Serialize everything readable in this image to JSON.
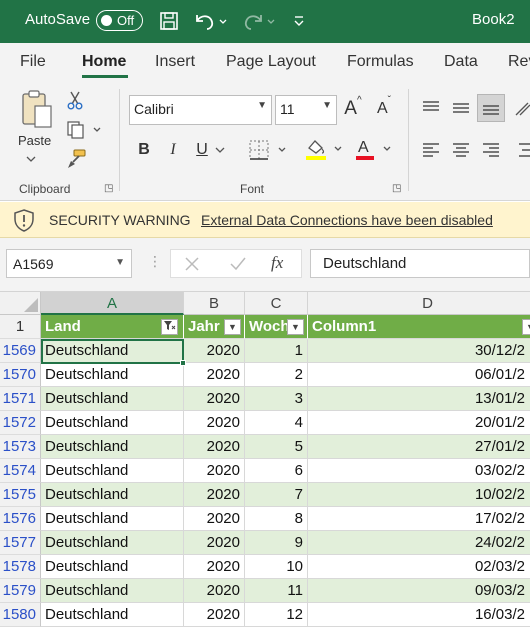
{
  "titlebar": {
    "autosave_label": "AutoSave",
    "autosave_state": "Off",
    "title": "Book2"
  },
  "menu": {
    "tabs": [
      "File",
      "Home",
      "Insert",
      "Page Layout",
      "Formulas",
      "Data",
      "Rev"
    ],
    "active": "Home"
  },
  "ribbon": {
    "paste_label": "Paste",
    "clipboard_label": "Clipboard",
    "font_label": "Font",
    "font_name": "Calibri",
    "font_size": "11",
    "bold": "B",
    "italic": "I",
    "underline": "U",
    "grow_font": "A",
    "shrink_font": "A",
    "font_color_letter": "A",
    "font_color": "#e81123",
    "highlight_color": "#ffff00"
  },
  "security": {
    "title": "SECURITY WARNING",
    "message": "External Data Connections have been disabled"
  },
  "formula_bar": {
    "name_box": "A1569",
    "fx": "fx",
    "value": "Deutschland"
  },
  "grid": {
    "columns": [
      "A",
      "B",
      "C",
      "D"
    ],
    "header_row_number": "1",
    "headers": [
      "Land",
      "Jahr",
      "Woch",
      "Column1"
    ],
    "rows": [
      {
        "num": "1569",
        "land": "Deutschland",
        "jahr": "2020",
        "woche": "1",
        "col1": "30/12/2"
      },
      {
        "num": "1570",
        "land": "Deutschland",
        "jahr": "2020",
        "woche": "2",
        "col1": "06/01/2"
      },
      {
        "num": "1571",
        "land": "Deutschland",
        "jahr": "2020",
        "woche": "3",
        "col1": "13/01/2"
      },
      {
        "num": "1572",
        "land": "Deutschland",
        "jahr": "2020",
        "woche": "4",
        "col1": "20/01/2"
      },
      {
        "num": "1573",
        "land": "Deutschland",
        "jahr": "2020",
        "woche": "5",
        "col1": "27/01/2"
      },
      {
        "num": "1574",
        "land": "Deutschland",
        "jahr": "2020",
        "woche": "6",
        "col1": "03/02/2"
      },
      {
        "num": "1575",
        "land": "Deutschland",
        "jahr": "2020",
        "woche": "7",
        "col1": "10/02/2"
      },
      {
        "num": "1576",
        "land": "Deutschland",
        "jahr": "2020",
        "woche": "8",
        "col1": "17/02/2"
      },
      {
        "num": "1577",
        "land": "Deutschland",
        "jahr": "2020",
        "woche": "9",
        "col1": "24/02/2"
      },
      {
        "num": "1578",
        "land": "Deutschland",
        "jahr": "2020",
        "woche": "10",
        "col1": "02/03/2"
      },
      {
        "num": "1579",
        "land": "Deutschland",
        "jahr": "2020",
        "woche": "11",
        "col1": "09/03/2"
      },
      {
        "num": "1580",
        "land": "Deutschland",
        "jahr": "2020",
        "woche": "12",
        "col1": "16/03/2"
      }
    ],
    "band_color": "#e2efda",
    "header_color": "#70ad47"
  }
}
